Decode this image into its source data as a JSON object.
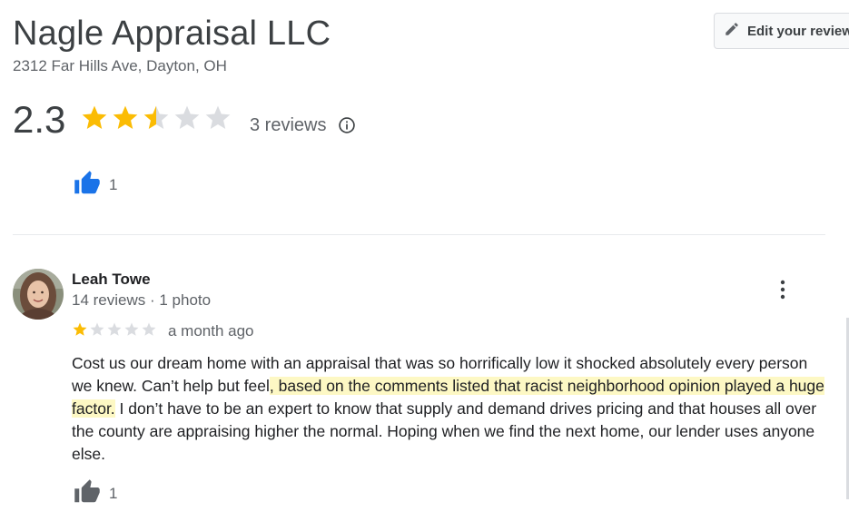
{
  "business": {
    "name": "Nagle Appraisal LLC",
    "address": "2312 Far Hills Ave, Dayton, OH"
  },
  "edit_button": {
    "label": "Edit your review",
    "icon": "pencil-icon"
  },
  "rating": {
    "value": "2.3",
    "stars": 2.3,
    "reviews_label": "3 reviews",
    "info_icon": "info-icon"
  },
  "previous_review": {
    "helpful_count": "1"
  },
  "review": {
    "name": "Leah Towe",
    "meta": "14 reviews · 1 photo",
    "stars": 1,
    "time": "a month ago",
    "text_part1": "Cost us our dream home with an appraisal that was so horrifically low it shocked absolutely every person we knew. Can’t help but feel",
    "text_highlight": ", based on the comments listed that racist neighborhood opinion played a huge factor.",
    "text_part2": " I don’t have to be an expert to know that supply and demand drives pricing and that houses all over the county are appraising higher the normal. Hoping when we find the next home, our lender uses anyone else.",
    "helpful_count": "1"
  },
  "colors": {
    "star_filled": "#fbbc04",
    "star_empty": "#dadce0",
    "thumb_active": "#1a73e8",
    "thumb_inactive": "#5f6368",
    "highlight": "#fdf8c4"
  }
}
